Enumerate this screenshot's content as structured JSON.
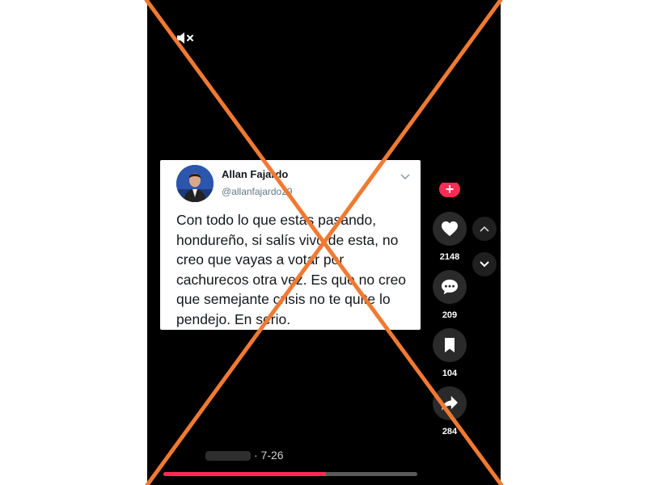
{
  "tweet": {
    "display_name": "Allan Fajardo",
    "handle": "@allanfajardo29",
    "text": "Con todo lo que estás pasando, hondureño, si salís vivo de esta, no creo que vayas a votar por cachurecos otra vez. Es que no creo que semejante crisis no te quite lo pendejo. En serio."
  },
  "actions": {
    "follow_symbol": "+",
    "likes": "2148",
    "comments": "209",
    "saves": "104",
    "shares": "284"
  },
  "video": {
    "date": "· 7-26",
    "progress_fraction": 0.64
  },
  "icons": {
    "mute": "speaker-muted-icon",
    "like": "heart-icon",
    "comment": "comment-icon",
    "save": "bookmark-icon",
    "share": "share-arrow-icon",
    "previous": "chevron-up-icon",
    "next": "chevron-down-icon"
  },
  "colors": {
    "overlay_cross": "#f07a32",
    "accent": "#fe2c55",
    "background": "#000000"
  }
}
